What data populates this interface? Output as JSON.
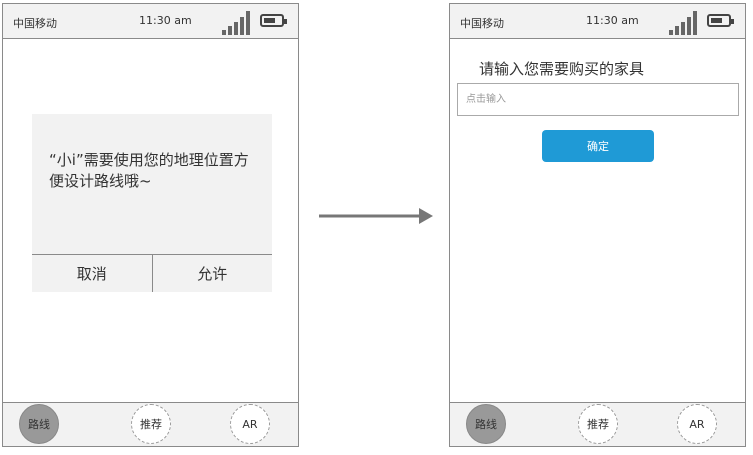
{
  "status_bar": {
    "carrier": "中国移动",
    "time": "11:30 am"
  },
  "permission_dialog": {
    "message": "“小i”需要使用您的地理位置方便设计路线哦~",
    "cancel_label": "取消",
    "allow_label": "允许"
  },
  "furniture_form": {
    "title": "请输入您需要购买的家具",
    "input_placeholder": "点击输入",
    "input_value": "",
    "confirm_label": "确定",
    "confirm_color": "#1f9ad6"
  },
  "tabs": [
    {
      "label": "路线",
      "active": true
    },
    {
      "label": "推荐",
      "active": false
    },
    {
      "label": "AR",
      "active": false
    }
  ],
  "flow_arrow_icon": "right-arrow-icon"
}
